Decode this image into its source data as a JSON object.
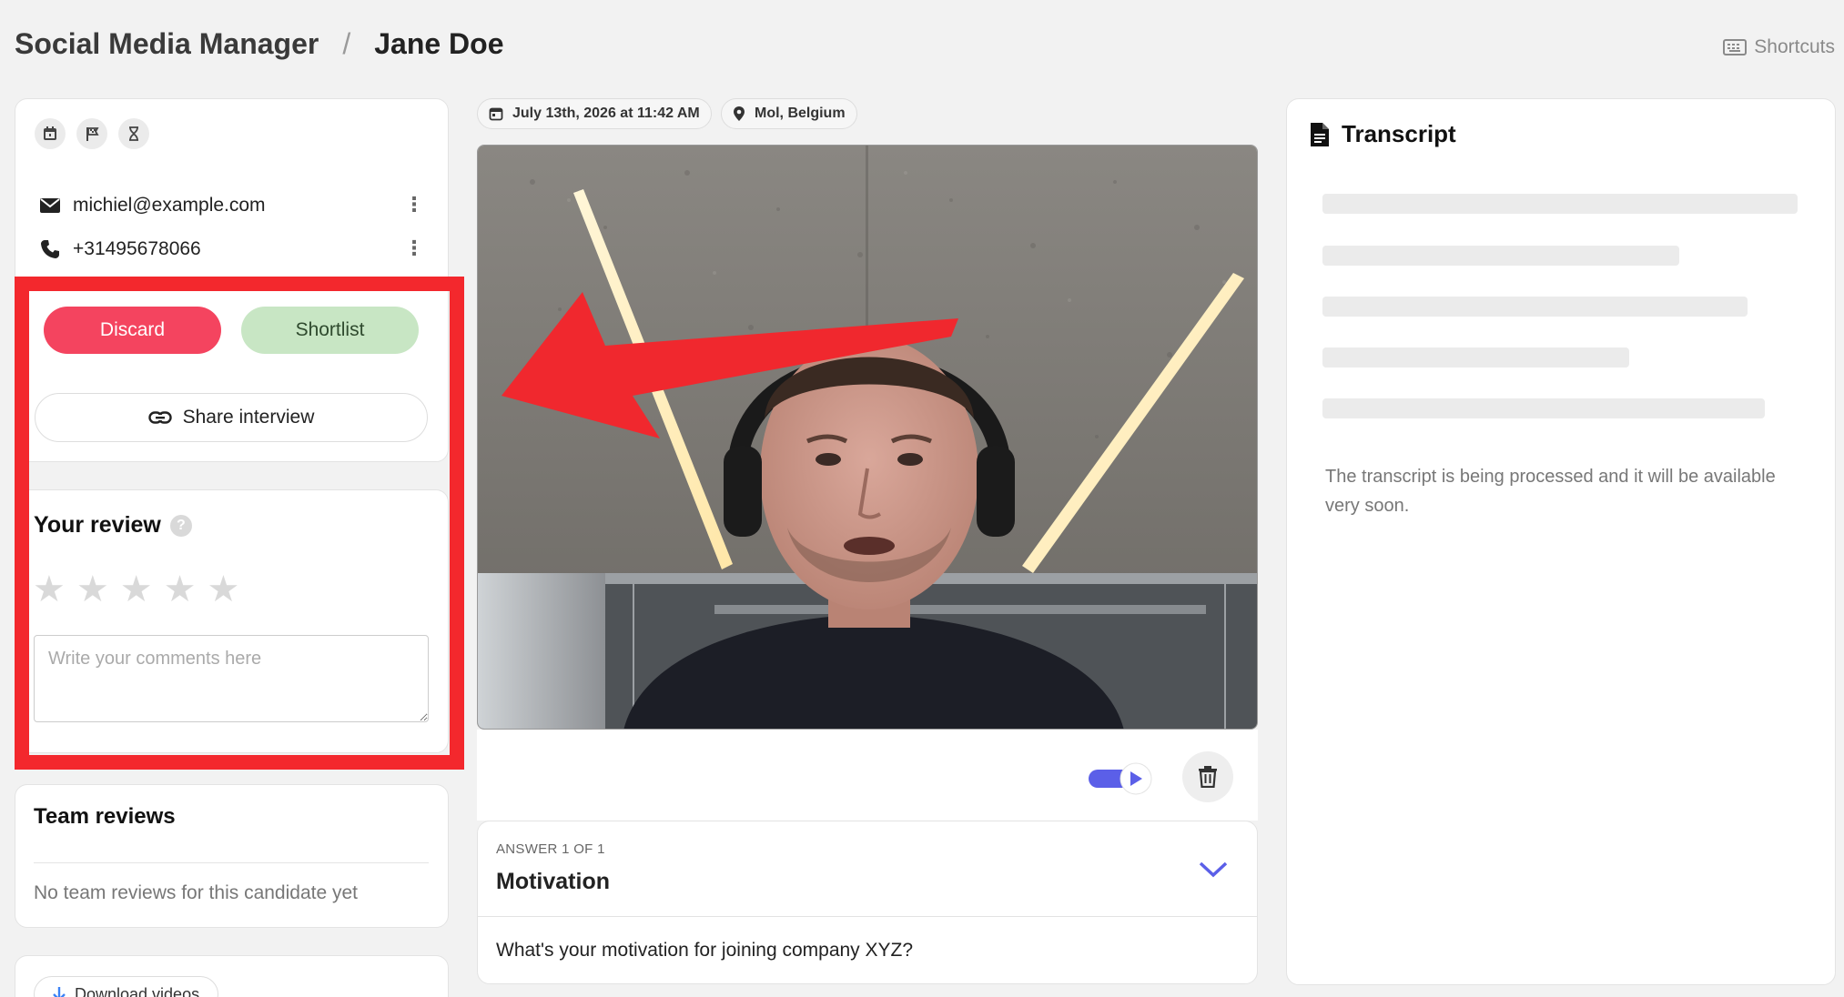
{
  "header": {
    "parent": "Social Media Manager",
    "separator": "/",
    "current": "Jane Doe",
    "shortcuts_label": "Shortcuts"
  },
  "contact": {
    "email": "michiel@example.com",
    "phone": "+31495678066",
    "icons": [
      "calendar-icon",
      "flag-icon",
      "hourglass-icon"
    ]
  },
  "actions": {
    "discard": "Discard",
    "shortlist": "Shortlist",
    "share": "Share interview"
  },
  "review": {
    "title": "Your review",
    "help": "?",
    "rating": 0,
    "rating_max": 5,
    "comment_placeholder": "Write your comments here"
  },
  "team_reviews": {
    "title": "Team reviews",
    "empty": "No team reviews for this candidate yet"
  },
  "download": {
    "label": "Download videos"
  },
  "meta": {
    "date": "July 13th, 2026 at 11:42 AM",
    "location": "Mol, Belgium"
  },
  "answer": {
    "kicker": "ANSWER 1 OF 1",
    "title": "Motivation",
    "question": "What's your motivation for joining company XYZ?"
  },
  "transcript": {
    "title": "Transcript",
    "message": "The transcript is being processed and it will be available very soon."
  },
  "colors": {
    "discard": "#f4445f",
    "shortlist": "#c8e6c4",
    "accent": "#5b5fe8",
    "highlight": "#f3282d"
  }
}
